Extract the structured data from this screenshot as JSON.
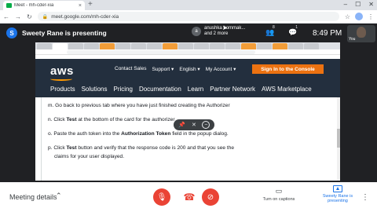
{
  "browser": {
    "tab_title": "Meet - mh-cder-xia",
    "tab_close": "×",
    "new_tab": "+",
    "window_controls": [
      "–",
      "☐",
      "✕"
    ],
    "url": "meet.google.com/mh-cder-xia"
  },
  "meet_top": {
    "presenter_initial": "S",
    "presenting_text": "Sweety Rane is presenting",
    "user_initial": "a",
    "user_line1": "anushka bommak...",
    "user_line2": "and 2 more",
    "people_count": "8",
    "chat_count": "1",
    "time": "8:49 PM",
    "self_label": "You"
  },
  "aws": {
    "logo": "aws",
    "top_links": [
      "Contact Sales",
      "Support ▾",
      "English ▾",
      "My Account ▾"
    ],
    "signin": "Sign In to the Console",
    "main_links": [
      "Products",
      "Solutions",
      "Pricing",
      "Documentation",
      "Learn",
      "Partner Network",
      "AWS Marketplace"
    ]
  },
  "steps": {
    "m": "m. Go back to previous tab where you have just finished creating the Authorizer",
    "n_pre": "n. Click ",
    "n_bold": "Test",
    "n_post": " at the bottom of the card for the authorizer",
    "o_pre": "o. Paste the auth token into the ",
    "o_bold": "Authorization Token",
    "o_post": " field in the popup dialog.",
    "p_pre": "p. Click ",
    "p_bold": "Test",
    "p_post": " button and verify that the response code is 200 and that you see the",
    "p_line2": "claims for your user displayed."
  },
  "bottom": {
    "meeting_details": "Meeting details",
    "captions_label": "Turn on captions",
    "presenter_line1": "Sweety Rane is",
    "presenter_line2": "presenting"
  }
}
